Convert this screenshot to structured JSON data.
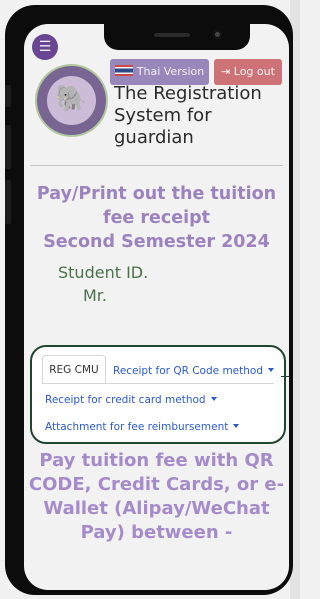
{
  "header": {
    "menu_icon": "hamburger-icon",
    "thai_button": "Thai Version",
    "logout_button": "Log out",
    "logout_icon": "sign-out-icon",
    "logo_icon": "elephant-seal",
    "site_title": "The Registration System for guardian"
  },
  "main": {
    "heading_line1": "Pay/Print out the tuition",
    "heading_line2": "fee receipt",
    "heading_line3": "Second Semester 2024",
    "student_label": "Student ID.",
    "student_title": "Mr."
  },
  "tabs": [
    {
      "label": "REG CMU",
      "active": true
    },
    {
      "label": "Receipt for QR Code method",
      "dropdown": true
    },
    {
      "label": "Receipt for credit card method",
      "dropdown": true
    },
    {
      "label": "Attachment for fee reimbursement",
      "dropdown": true
    }
  ],
  "footer": {
    "text": "Pay tuition fee with QR CODE, Credit Cards, or e-Wallet (Alipay/WeChat Pay) between -"
  },
  "colors": {
    "accent_purple": "#a58bc9",
    "thai_button": "#a18fc4",
    "logout_button": "#d8797d",
    "link_blue": "#2a5ad2",
    "student_green": "#4f7a4f"
  }
}
